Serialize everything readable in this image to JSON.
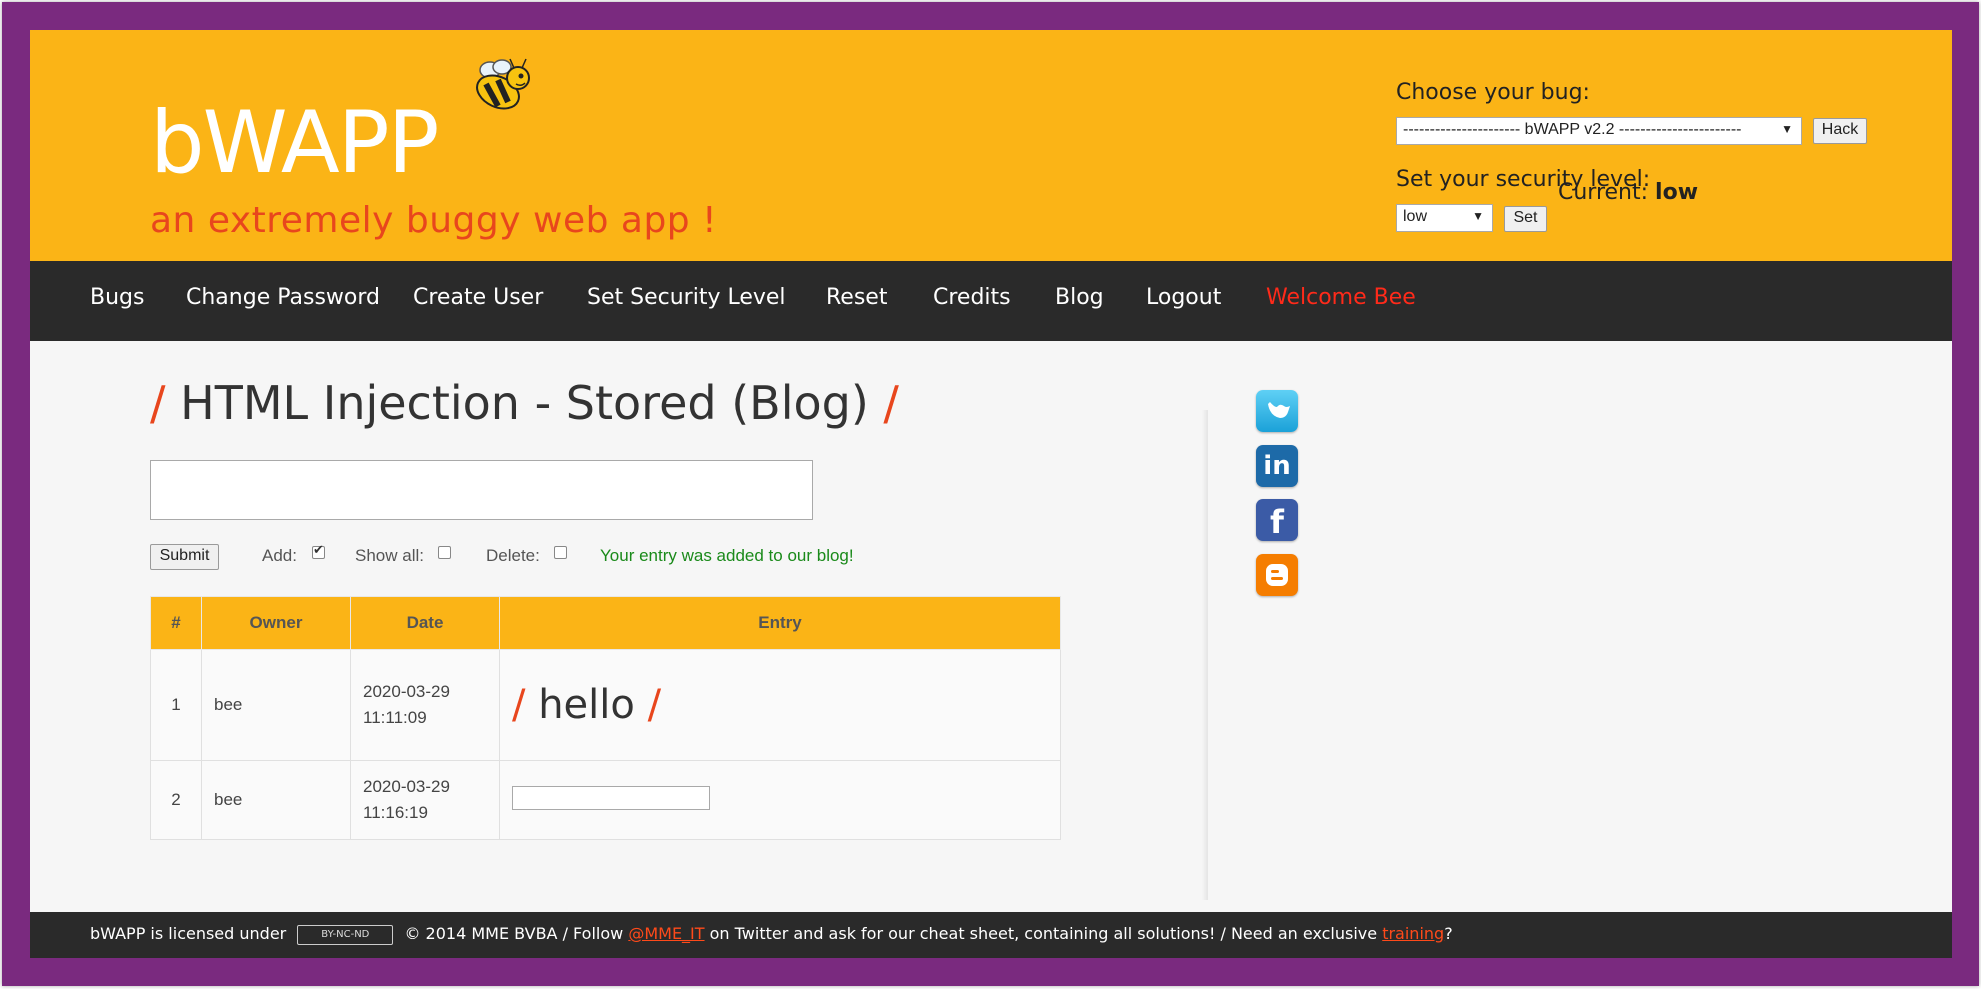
{
  "header": {
    "logo": "bWAPP",
    "tagline": "an extremely buggy web app !",
    "choose_bug_label": "Choose your bug:",
    "bug_select_value": "---------------------- bWAPP v2.2 -----------------------",
    "hack_button": "Hack",
    "security_label": "Set your security level:",
    "security_select_value": "low",
    "set_button": "Set",
    "current_label": "Current:",
    "current_value": "low"
  },
  "nav": {
    "items": [
      "Bugs",
      "Change Password",
      "Create User",
      "Set Security Level",
      "Reset",
      "Credits",
      "Blog",
      "Logout",
      "Welcome Bee"
    ]
  },
  "main": {
    "title": "HTML Injection - Stored (Blog)",
    "title_slash": "/",
    "submit_button": "Submit",
    "add_label": "Add:",
    "show_all_label": "Show all:",
    "delete_label": "Delete:",
    "status_message": "Your entry was added to our blog!",
    "table": {
      "headers": [
        "#",
        "Owner",
        "Date",
        "Entry"
      ],
      "rows": [
        {
          "num": "1",
          "owner": "bee",
          "date": "2020-03-29",
          "time": "11:11:09",
          "entry": "hello"
        },
        {
          "num": "2",
          "owner": "bee",
          "date": "2020-03-29",
          "time": "11:16:19",
          "entry": ""
        }
      ]
    }
  },
  "social": [
    "twitter-icon",
    "linkedin-icon",
    "facebook-icon",
    "blogger-icon"
  ],
  "footer": {
    "text1": "bWAPP is licensed under",
    "cc_badge": "BY-NC-ND",
    "text2": "© 2014 MME BVBA / Follow",
    "twitter_link": "@MME_IT",
    "text3": "on Twitter and ask for our cheat sheet, containing all solutions! / Need an exclusive",
    "training_link": "training",
    "text4": "?"
  },
  "colors": {
    "header_bg": "#fbb416",
    "nav_bg": "#2a2a2a",
    "frame": "#7a2a7f",
    "accent": "#e8461d",
    "welcome": "#ff2a1a",
    "success": "#1a8a1a"
  }
}
